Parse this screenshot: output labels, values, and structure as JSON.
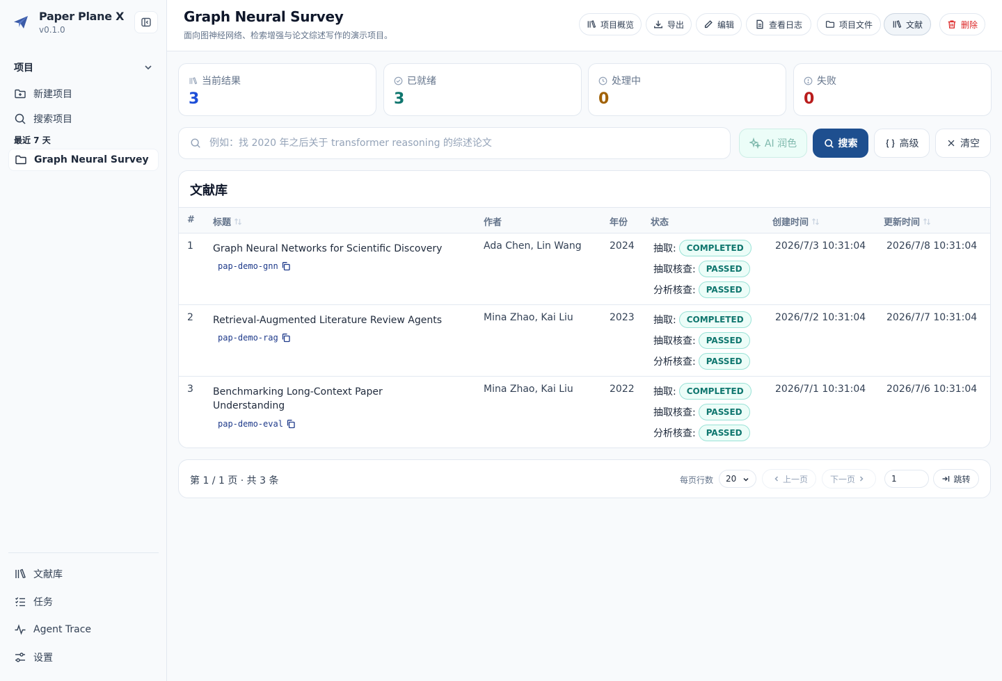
{
  "app": {
    "name": "Paper Plane X",
    "version": "v0.1.0"
  },
  "sidebar": {
    "section_label": "项目",
    "actions": [
      {
        "label": "新建项目",
        "icon": "folder-plus-icon"
      },
      {
        "label": "搜索项目",
        "icon": "search-icon"
      }
    ],
    "recent_label": "最近 7 天",
    "recent_projects": [
      {
        "label": "Graph Neural Survey",
        "icon": "folder-icon",
        "active": true
      }
    ],
    "bottom_nav": [
      {
        "label": "文献库",
        "icon": "library-icon"
      },
      {
        "label": "任务",
        "icon": "task-list-icon"
      },
      {
        "label": "Agent Trace",
        "icon": "activity-icon"
      },
      {
        "label": "设置",
        "icon": "settings-sliders-icon"
      }
    ]
  },
  "header": {
    "title": "Graph Neural Survey",
    "subtitle": "面向图神经网络、检索增强与论文综述写作的演示项目。",
    "buttons": [
      {
        "label": "项目概览",
        "icon": "library-icon"
      },
      {
        "label": "导出",
        "icon": "download-icon"
      },
      {
        "label": "编辑",
        "icon": "pencil-icon"
      },
      {
        "label": "查看日志",
        "icon": "file-text-icon"
      },
      {
        "label": "项目文件",
        "icon": "folder-icon"
      },
      {
        "label": "文献",
        "icon": "library-icon",
        "selected": true
      },
      {
        "label": "删除",
        "icon": "trash-icon",
        "danger": true
      }
    ]
  },
  "stats": [
    {
      "label": "当前结果",
      "value": "3",
      "icon": "library-icon",
      "color": "#1d4ed8"
    },
    {
      "label": "已就绪",
      "value": "3",
      "icon": "check-circle-icon",
      "color": "#0f766e"
    },
    {
      "label": "处理中",
      "value": "0",
      "icon": "clock-icon",
      "color": "#a16207"
    },
    {
      "label": "失败",
      "value": "0",
      "icon": "alert-circle-icon",
      "color": "#b91c1c"
    }
  ],
  "search": {
    "placeholder": "例如：找 2020 年之后关于 transformer reasoning 的综述论文",
    "value": "",
    "ai_label": "AI 润色",
    "search_label": "搜索",
    "advanced_label": "高级",
    "clear_label": "清空"
  },
  "library": {
    "title": "文献库",
    "columns": {
      "index": "#",
      "title": "标题",
      "authors": "作者",
      "year": "年份",
      "status": "状态",
      "created": "创建时间",
      "updated": "更新时间"
    },
    "rows": [
      {
        "index": "1",
        "title": "Graph Neural Networks for Scientific Discovery",
        "code": "pap-demo-gnn",
        "authors": "Ada Chen, Lin Wang",
        "year": "2024",
        "statuses": [
          {
            "label": "抽取:",
            "badge": "COMPLETED"
          },
          {
            "label": "抽取核查:",
            "badge": "PASSED"
          },
          {
            "label": "分析核查:",
            "badge": "PASSED"
          }
        ],
        "created": "2026/7/3 10:31:04",
        "updated": "2026/7/8 10:31:04"
      },
      {
        "index": "2",
        "title": "Retrieval-Augmented Literature Review Agents",
        "code": "pap-demo-rag",
        "authors": "Mina Zhao, Kai Liu",
        "year": "2023",
        "statuses": [
          {
            "label": "抽取:",
            "badge": "COMPLETED"
          },
          {
            "label": "抽取核查:",
            "badge": "PASSED"
          },
          {
            "label": "分析核查:",
            "badge": "PASSED"
          }
        ],
        "created": "2026/7/2 10:31:04",
        "updated": "2026/7/7 10:31:04"
      },
      {
        "index": "3",
        "title": "Benchmarking Long-Context Paper Understanding",
        "code": "pap-demo-eval",
        "authors": "Mina Zhao, Kai Liu",
        "year": "2022",
        "statuses": [
          {
            "label": "抽取:",
            "badge": "COMPLETED"
          },
          {
            "label": "抽取核查:",
            "badge": "PASSED"
          },
          {
            "label": "分析核查:",
            "badge": "PASSED"
          }
        ],
        "created": "2026/7/1 10:31:04",
        "updated": "2026/7/6 10:31:04"
      }
    ]
  },
  "pagination": {
    "info": "第 1 / 1 页 · 共 3 条",
    "rows_label": "每页行数",
    "rows_value": "20",
    "prev_label": "上一页",
    "next_label": "下一页",
    "page_value": "1",
    "jump_label": "跳转"
  }
}
